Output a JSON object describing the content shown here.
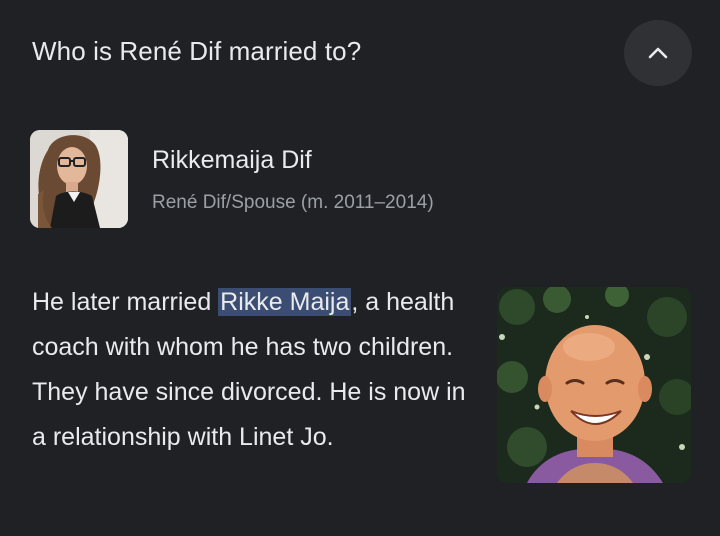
{
  "question": {
    "text": "Who is René Dif married to?",
    "expand_state_icon": "chevron-up-icon"
  },
  "entity": {
    "name": "Rikkemaija Dif",
    "subtitle": "René Dif/Spouse (m. 2011–2014)"
  },
  "snippet": {
    "before": "He later married ",
    "highlight": "Rikke Maija",
    "after": ", a health coach with whom he has two children. They have since divorced. He is now in a relationship with Linet Jo."
  },
  "colors": {
    "background": "#202124",
    "text": "#e8eaed",
    "secondary_text": "#9aa0a6",
    "highlight": "#3c4d73",
    "button_bg": "#303134"
  }
}
